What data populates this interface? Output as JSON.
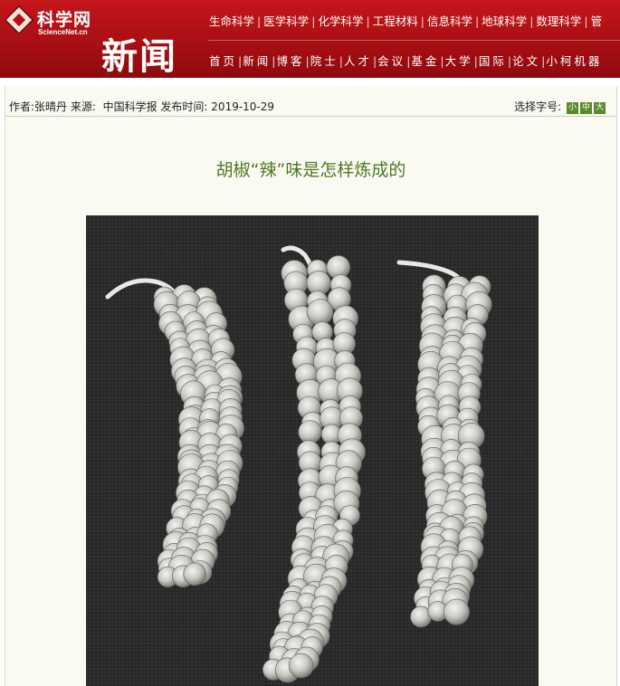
{
  "brand": {
    "logo_title": "科学网",
    "logo_sub": "ScienceNet.cn",
    "section": "新闻"
  },
  "nav": {
    "row1": [
      "生命科学",
      "医学科学",
      "化学科学",
      "工程材料",
      "信息科学",
      "地球科学",
      "数理科学",
      "管"
    ],
    "row2": [
      "首页",
      "新闻",
      "博客",
      "院士",
      "人才",
      "会议",
      "基金",
      "大学",
      "国际",
      "论文",
      "小柯机器"
    ]
  },
  "meta": {
    "author_label": "作者:",
    "author": "张晴丹",
    "source_label": "来源:",
    "source": "中国科学报",
    "time_label": "发布时间:",
    "time": "2019-10-29",
    "font_size_label": "选择字号:",
    "sizes": [
      "小",
      "中",
      "大"
    ]
  },
  "article": {
    "title": "胡椒“辣”味是怎样炼成的"
  },
  "icons": {
    "logo": "sciencenet-logo-icon",
    "photo": "pepper-spikes-photo"
  }
}
